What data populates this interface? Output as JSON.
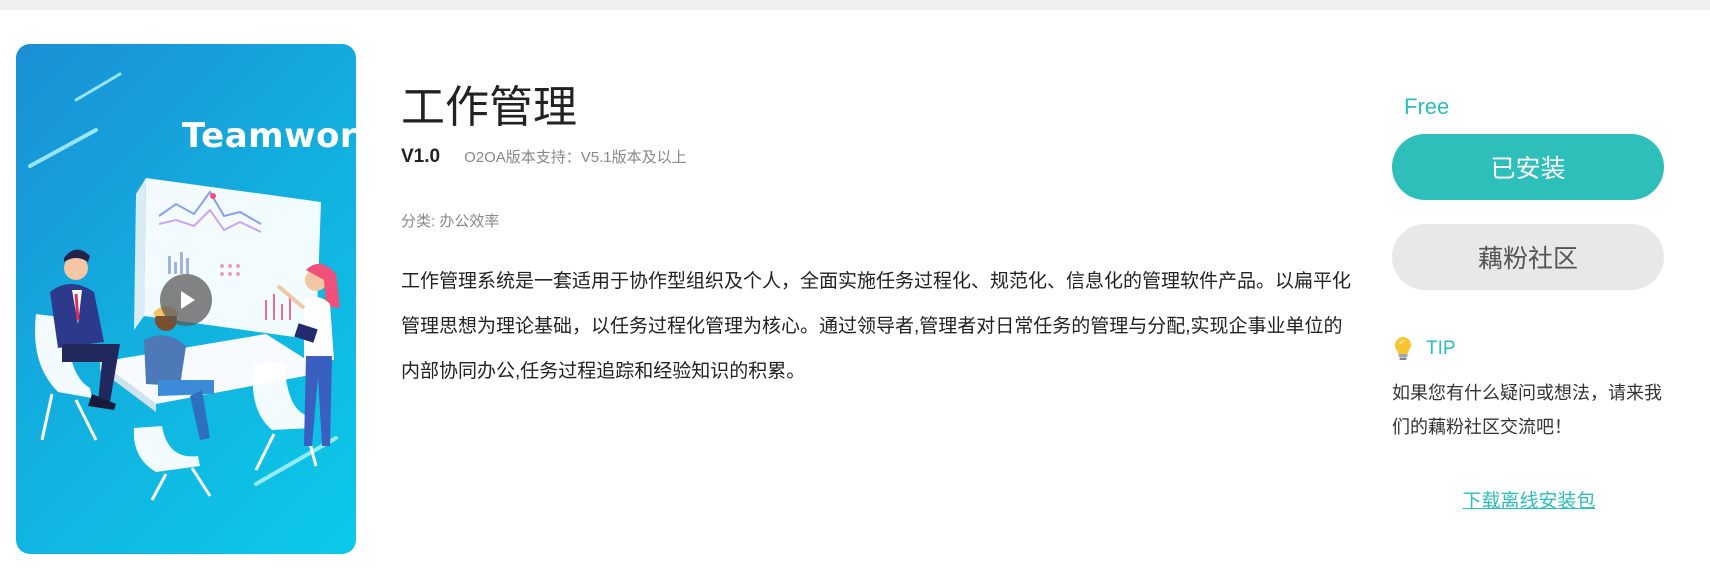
{
  "app": {
    "title": "工作管理",
    "version": "V1.0",
    "support": "O2OA版本支持：V5.1版本及以上",
    "category": "分类: 办公效率",
    "description": "工作管理系统是一套适用于协作型组织及个人，全面实施任务过程化、规范化、信息化的管理软件产品。以扁平化管理思想为理论基础，以任务过程化管理为核心。通过领导者,管理者对日常任务的管理与分配,实现企事业单位的内部协同办公,任务过程追踪和经验知识的积累。"
  },
  "cover": {
    "banner_text": "Teamwork",
    "play_icon": "play-icon"
  },
  "sidebar": {
    "price": "Free",
    "installed_label": "已安装",
    "community_label": "藕粉社区",
    "tip_icon": "lightbulb-icon",
    "tip_label": "TIP",
    "tip_text": "如果您有什么疑问或想法，请来我们的藕粉社区交流吧！",
    "download_label": "下载离线安装包"
  },
  "colors": {
    "accent": "#2ebfba",
    "secondary_button": "#e8e8e8",
    "cover_gradient_start": "#1b8fd6",
    "cover_gradient_end": "#0bc9e8"
  }
}
